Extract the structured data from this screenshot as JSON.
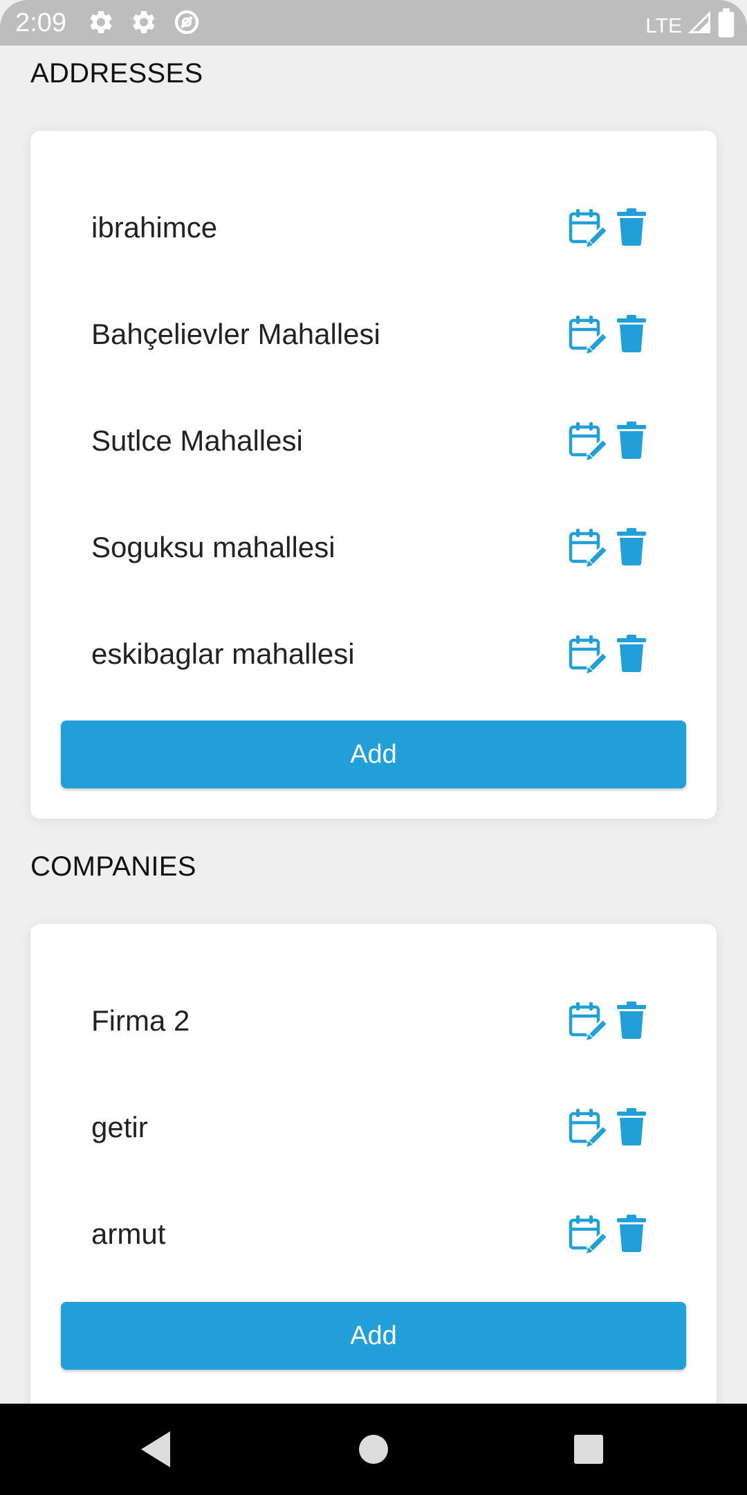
{
  "status_bar": {
    "time": "2:09",
    "left_icons": [
      "gear-icon",
      "gear-icon",
      "data-saver-icon"
    ],
    "network": "LTE",
    "right_icons": [
      "signal-icon",
      "battery-icon"
    ]
  },
  "addresses": {
    "title": "ADDRESSES",
    "items": [
      {
        "label": "ibrahimce"
      },
      {
        "label": "Bahçelievler Mahallesi"
      },
      {
        "label": "Sutlce Mahallesi"
      },
      {
        "label": "Soguksu mahallesi"
      },
      {
        "label": "eskibaglar mahallesi"
      }
    ],
    "add_label": "Add"
  },
  "companies": {
    "title": "COMPANIES",
    "items": [
      {
        "label": "Firma 2"
      },
      {
        "label": "getir"
      },
      {
        "label": "armut"
      }
    ],
    "add_label": "Add"
  },
  "row_icons": {
    "edit": "calendar-edit-icon",
    "delete": "trash-icon"
  },
  "nav_bar": {
    "buttons": [
      "back-icon",
      "home-icon",
      "recents-icon"
    ]
  },
  "colors": {
    "accent": "#219FD9",
    "background": "#EFEFEF",
    "card": "#FFFFFF",
    "status_bar": "#BDBDBD",
    "nav_bar": "#000000"
  }
}
